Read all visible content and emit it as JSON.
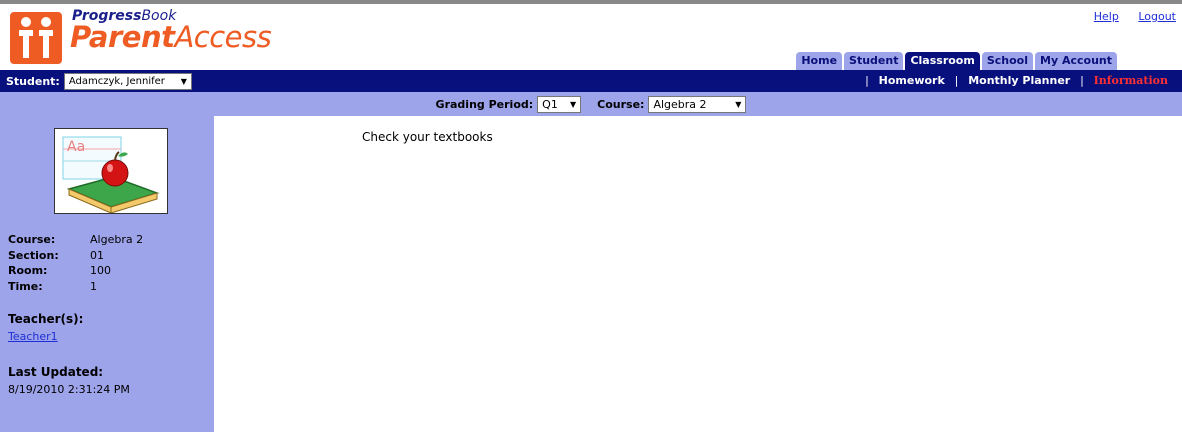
{
  "brand": {
    "line1_prefix": "Progress",
    "line1_suffix": "Book",
    "line2_prefix": "Parent",
    "line2_suffix": "Access",
    "accent": "#ee5c24",
    "navy": "#08107e",
    "lavender": "#9ea4ea"
  },
  "top_links": {
    "help": "Help",
    "logout": "Logout"
  },
  "tabs": [
    {
      "label": "Home",
      "active": false
    },
    {
      "label": "Student",
      "active": false
    },
    {
      "label": "Classroom",
      "active": true
    },
    {
      "label": "School",
      "active": false
    },
    {
      "label": "My Account",
      "active": false
    }
  ],
  "student": {
    "label": "Student:",
    "selected": "Adamczyk, Jennifer"
  },
  "subnav": {
    "homework": "Homework",
    "planner": "Monthly Planner",
    "information": "Information"
  },
  "filters": {
    "grading_period_label": "Grading Period:",
    "grading_period_value": "Q1",
    "course_label": "Course:",
    "course_value": "Algebra 2"
  },
  "sidebar": {
    "course_label": "Course:",
    "course_value": "Algebra 2",
    "section_label": "Section:",
    "section_value": "01",
    "room_label": "Room:",
    "room_value": "100",
    "time_label": "Time:",
    "time_value": "1",
    "teachers_heading": "Teacher(s):",
    "teacher_link": "Teacher1",
    "updated_heading": "Last Updated:",
    "updated_value": "8/19/2010 2:31:24 PM"
  },
  "main": {
    "message": "Check your textbooks"
  }
}
